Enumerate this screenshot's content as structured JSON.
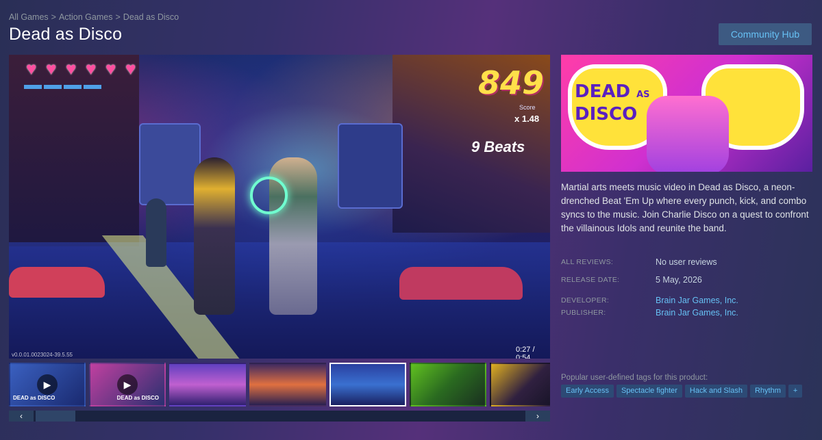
{
  "breadcrumb": {
    "items": [
      "All Games",
      "Action Games",
      "Dead as Disco"
    ],
    "separator": ">"
  },
  "title": "Dead as Disco",
  "community_hub": "Community Hub",
  "media": {
    "hud": {
      "hearts": 6,
      "score": "849",
      "score_label": "Score",
      "multiplier": "x 1.48",
      "beats": "9 Beats",
      "version": "v0.0.01.0023024-39.5.55",
      "video_time": "0:27 / 0:54"
    },
    "thumbnails": [
      {
        "type": "video",
        "logo": "DEAD as DISCO",
        "selected": false
      },
      {
        "type": "video",
        "logo": "DEAD as DISCO",
        "selected": false
      },
      {
        "type": "image",
        "selected": false
      },
      {
        "type": "image",
        "selected": false
      },
      {
        "type": "image",
        "selected": true
      },
      {
        "type": "image",
        "selected": false
      },
      {
        "type": "image",
        "selected": false
      }
    ],
    "scroll_left": "‹",
    "scroll_right": "›"
  },
  "capsule": {
    "logo_line1": "DEAD",
    "logo_small": "AS",
    "logo_line2": "DISCO"
  },
  "description": "Martial arts meets music video in Dead as Disco, a neon-drenched Beat 'Em Up where every punch, kick, and combo syncs to the music. Join Charlie Disco on a quest to confront the villainous Idols and reunite the band.",
  "info": {
    "all_reviews_label": "ALL REVIEWS:",
    "all_reviews_value": "No user reviews",
    "release_date_label": "RELEASE DATE:",
    "release_date_value": "5 May, 2026",
    "developer_label": "DEVELOPER:",
    "developer_value": "Brain Jar Games, Inc.",
    "publisher_label": "PUBLISHER:",
    "publisher_value": "Brain Jar Games, Inc."
  },
  "tags": {
    "label": "Popular user-defined tags for this product:",
    "items": [
      "Early Access",
      "Spectacle fighter",
      "Hack and Slash",
      "Rhythm",
      "+"
    ]
  },
  "colors": {
    "accent_link": "#66c0f4",
    "button_bg": "#3d5a82",
    "tag_bg": "#2d4a75"
  }
}
